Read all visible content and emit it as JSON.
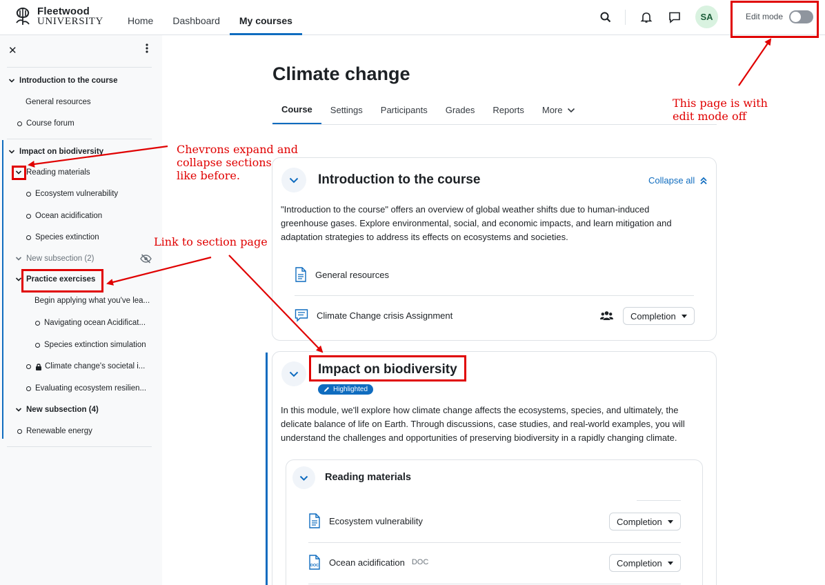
{
  "brand": {
    "line1": "Fleetwood",
    "line2": "UNIVERSITY"
  },
  "nav": {
    "items": [
      "Home",
      "Dashboard",
      "My courses"
    ]
  },
  "user": {
    "initials": "SA"
  },
  "edit_mode": {
    "label": "Edit mode",
    "on": false
  },
  "drawer": {
    "close": "✕",
    "items": {
      "intro": "Introduction to the course",
      "general": "General resources",
      "forum": "Course forum",
      "impact": "Impact on biodiversity",
      "reading": "Reading materials",
      "eco": "Ecosystem vulnerability",
      "ocean": "Ocean acidification",
      "species": "Species extinction",
      "newsub2": "New subsection (2)",
      "practice": "Practice exercises",
      "begin": "Begin applying what you've lea...",
      "navigating": "Navigating ocean Acidificat...",
      "simulation": "Species extinction simulation",
      "societal": "Climate change's societal i...",
      "evaluating": "Evaluating ecosystem resilien...",
      "newsub4": "New subsection (4)",
      "renewable": "Renewable energy"
    }
  },
  "page": {
    "title": "Climate change"
  },
  "tabs": [
    "Course",
    "Settings",
    "Participants",
    "Grades",
    "Reports",
    "More"
  ],
  "intro_section": {
    "title": "Introduction to the course",
    "collapse_all": "Collapse all",
    "desc_l1": "\"Introduction to the course\" offers an overview of global weather shifts due to human-induced",
    "desc_l2": "greenhouse gases. Explore environmental, social, and economic impacts, and learn mitigation and",
    "desc_l3": "adaptation strategies to address its effects on ecosystems and societies.",
    "activities": [
      "General resources",
      "Climate Change crisis Assignment"
    ]
  },
  "impact_section": {
    "title": "Impact on biodiversity",
    "badge": "Highlighted",
    "desc_l1": "In this module, we'll explore how climate change affects the ecosystems, species, and ultimately, the",
    "desc_l2": "delicate balance of life on Earth. Through discussions, case studies, and real-world examples, you will",
    "desc_l3": "understand the challenges and opportunities of preserving biodiversity in a rapidly changing climate."
  },
  "subsection": {
    "title": "Reading materials",
    "activities": [
      "Ecosystem vulnerability",
      "Ocean acidification"
    ],
    "doc_tag": "DOC"
  },
  "completion_label": "Completion",
  "annotations": {
    "edit_note_l1": "This page is with",
    "edit_note_l2": "edit mode off",
    "chev_note_l1": "Chevrons expand and",
    "chev_note_l2": "collapse sections",
    "chev_note_l3": "like before.",
    "link_note": "Link to section page"
  },
  "colors": {
    "accent": "#0f6cbf",
    "annotation": "#e00000"
  }
}
